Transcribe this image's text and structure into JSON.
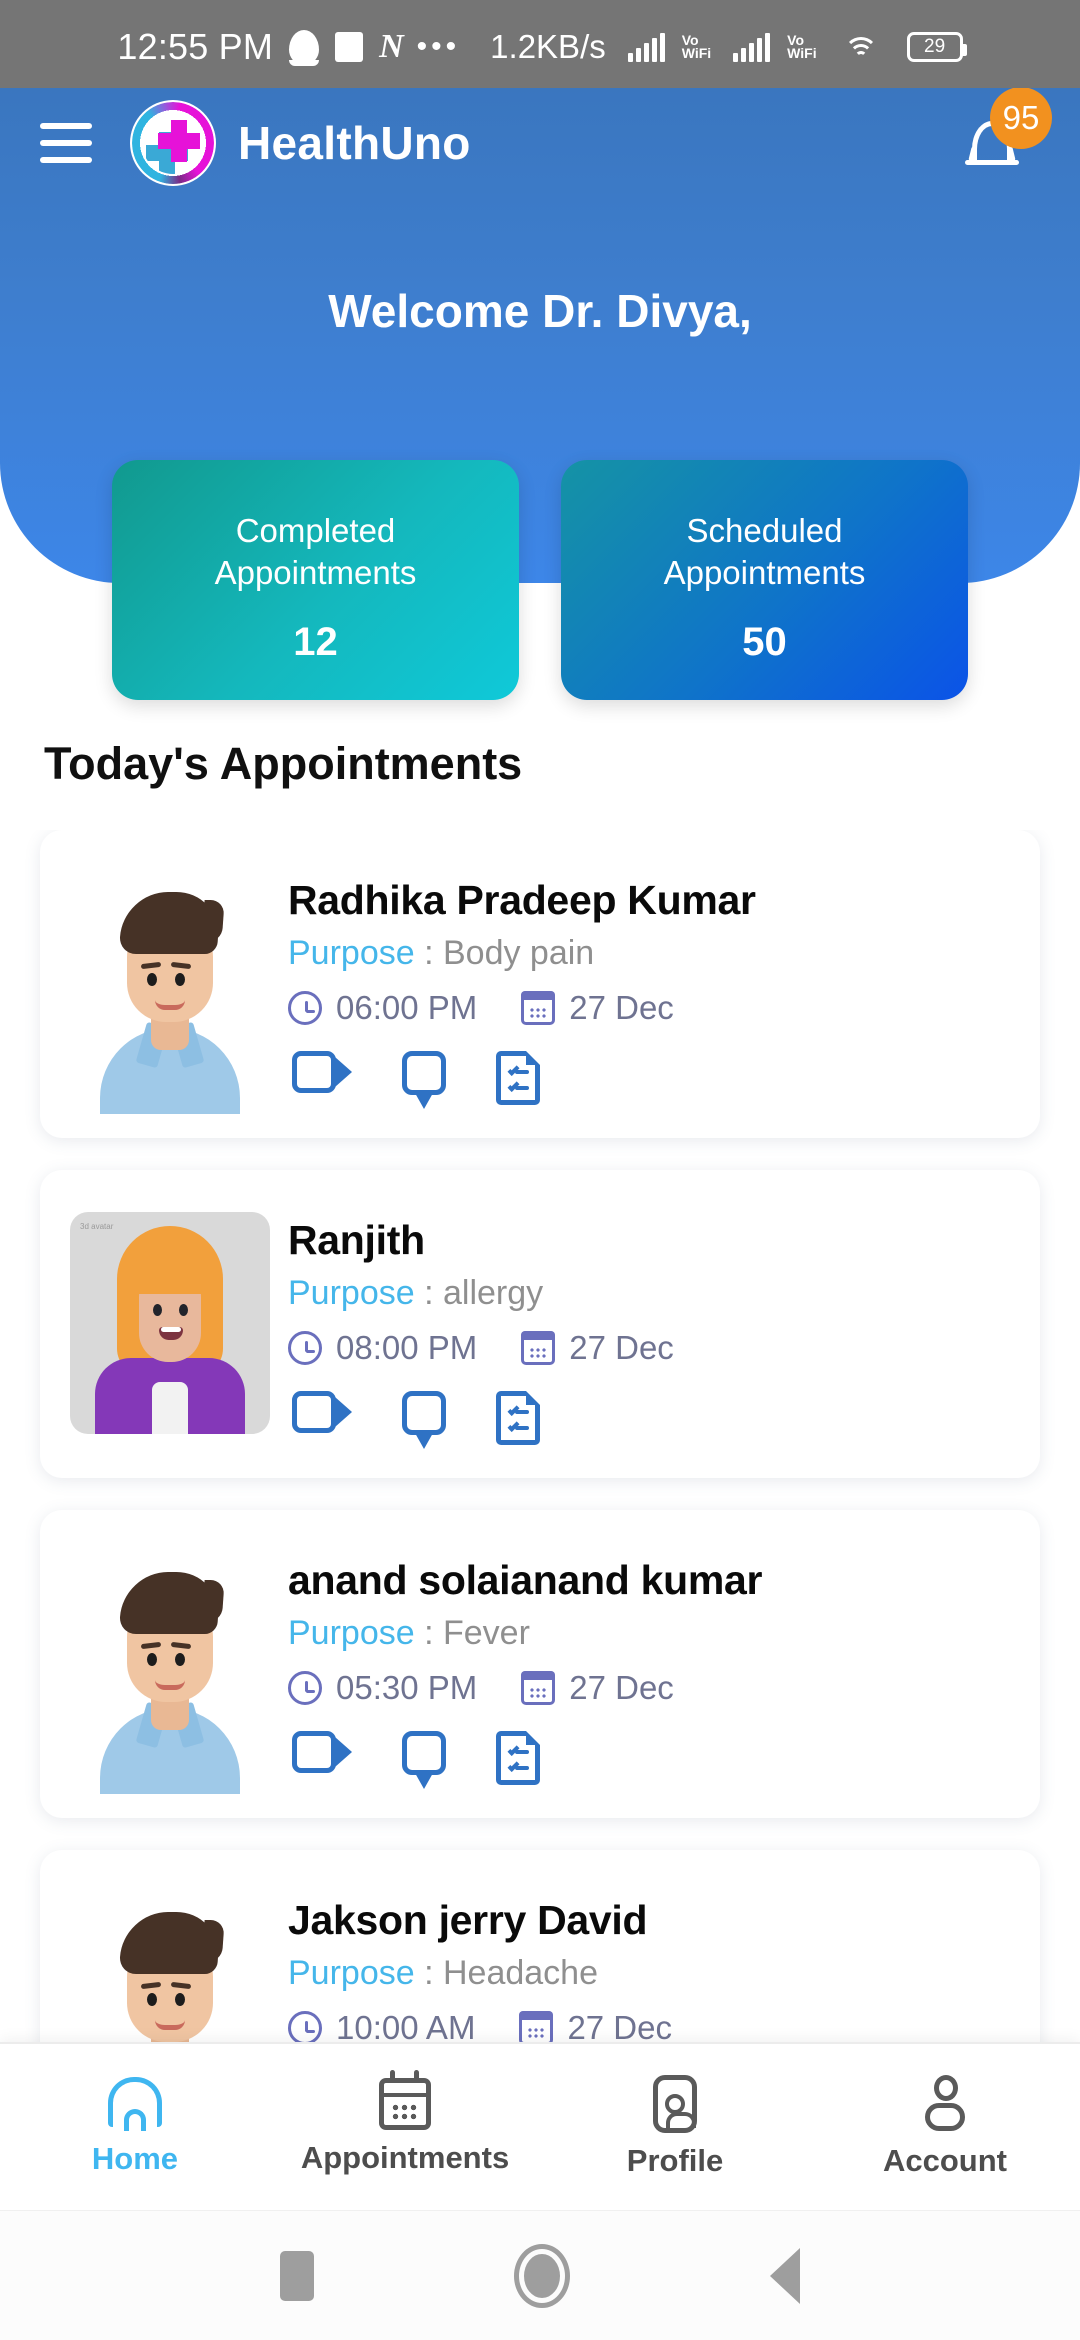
{
  "status_bar": {
    "time": "12:55 PM",
    "icons": [
      "snapchat-icon",
      "square-icon",
      "n-slash-icon",
      "more-dots-icon"
    ],
    "data_rate": "1.2KB/s",
    "signal_1_label_top": "Vo",
    "signal_1_label_bottom": "WiFi",
    "signal_2_label_top": "Vo",
    "signal_2_label_bottom": "WiFi",
    "battery": "29"
  },
  "header": {
    "brand": "HealthUno",
    "menu_icon": "hamburger-icon",
    "bell_icon": "bell-icon",
    "notification_count": "95",
    "welcome": "Welcome Dr. Divya,",
    "bg_color": "#3d7ece",
    "badge_color": "#f2911f"
  },
  "stats": [
    {
      "label": "Completed\nAppointments",
      "label_line1": "Completed",
      "label_line2": "Appointments",
      "value": "12",
      "accent": "#0fc9d9"
    },
    {
      "label": "Scheduled\nAppointments",
      "label_line1": "Scheduled",
      "label_line2": "Appointments",
      "value": "50",
      "accent": "#0b53e8"
    }
  ],
  "section": {
    "title": "Today's Appointments"
  },
  "appointments": [
    {
      "name": "Radhika Pradeep Kumar",
      "purpose_label": "Purpose",
      "purpose_sep": " : ",
      "purpose_value": "Body pain",
      "time": "06:00 PM",
      "date": "27 Dec",
      "avatar": "man-blue-shirt",
      "actions": [
        "video-call-icon",
        "chat-icon",
        "prescription-icon"
      ]
    },
    {
      "name": "Ranjith",
      "purpose_label": "Purpose",
      "purpose_sep": " : ",
      "purpose_value": "allergy",
      "time": "08:00 PM",
      "date": "27 Dec",
      "avatar": "woman-purple-blazer",
      "actions": [
        "video-call-icon",
        "chat-icon",
        "prescription-icon"
      ]
    },
    {
      "name": "anand solaianand kumar",
      "purpose_label": "Purpose",
      "purpose_sep": " : ",
      "purpose_value": "Fever",
      "time": "05:30 PM",
      "date": "27 Dec",
      "avatar": "man-blue-shirt",
      "actions": [
        "video-call-icon",
        "chat-icon",
        "prescription-icon"
      ]
    },
    {
      "name": "Jakson jerry David",
      "purpose_label": "Purpose",
      "purpose_sep": " : ",
      "purpose_value": "Headache",
      "time": "10:00 AM",
      "date": "27 Dec",
      "avatar": "man-blue-shirt",
      "actions": [
        "video-call-icon",
        "chat-icon",
        "prescription-icon"
      ]
    }
  ],
  "bottom_nav": {
    "active_color": "#3fb6f0",
    "items": [
      {
        "label": "Home",
        "icon": "home-icon",
        "active": true
      },
      {
        "label": "Appointments",
        "icon": "calendar-icon",
        "active": false
      },
      {
        "label": "Profile",
        "icon": "profile-card-icon",
        "active": false
      },
      {
        "label": "Account",
        "icon": "person-icon",
        "active": false
      }
    ]
  },
  "android_nav": {
    "recents": "recents-square-icon",
    "home": "home-circle-icon",
    "back": "back-triangle-icon"
  }
}
